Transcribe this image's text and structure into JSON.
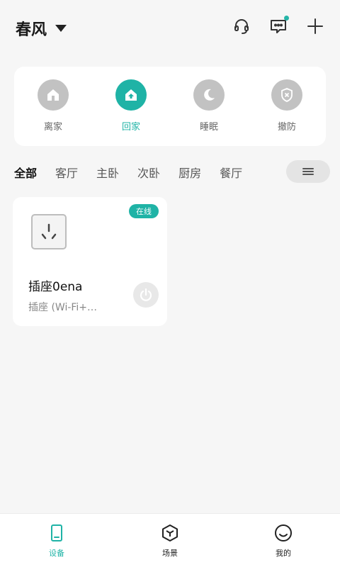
{
  "header": {
    "home_name": "春风",
    "icons": [
      "customer-service-icon",
      "message-icon",
      "add-icon"
    ],
    "accent": "#1fb3a6"
  },
  "modes": [
    {
      "label": "离家",
      "icon": "away-home-icon",
      "active": false
    },
    {
      "label": "回家",
      "icon": "come-home-icon",
      "active": true
    },
    {
      "label": "睡眠",
      "icon": "moon-icon",
      "active": false
    },
    {
      "label": "撤防",
      "icon": "disarm-shield-icon",
      "active": false
    }
  ],
  "rooms": {
    "tabs": [
      "全部",
      "客厅",
      "主卧",
      "次卧",
      "厨房",
      "餐厅"
    ],
    "active_index": 0,
    "menu_icon": "menu-icon"
  },
  "device": {
    "status": "在线",
    "name": "插座0ena",
    "type": "插座 (Wi-Fi+…",
    "icon": "socket-icon",
    "power_icon": "power-icon"
  },
  "bottom_nav": [
    {
      "label": "设备",
      "icon": "device-icon",
      "active": true
    },
    {
      "label": "场景",
      "icon": "scene-cube-icon",
      "active": false
    },
    {
      "label": "我的",
      "icon": "smile-icon",
      "active": false
    }
  ]
}
